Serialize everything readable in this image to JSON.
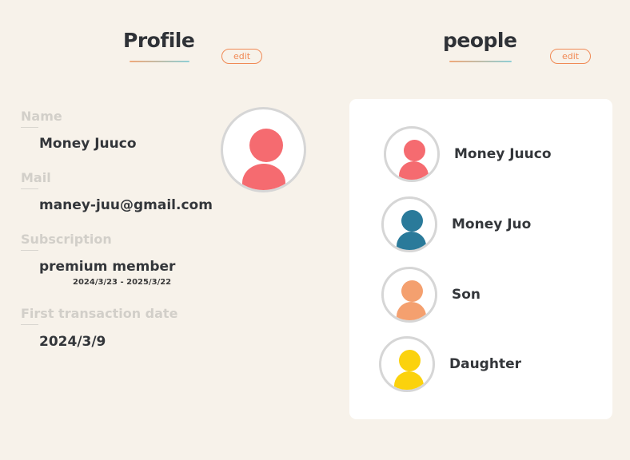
{
  "profile": {
    "title": "Profile",
    "edit_label": "edit",
    "fields": [
      {
        "label": "Name",
        "value": "Money Juuco"
      },
      {
        "label": "Mail",
        "value": "maney-juu@gmail.com"
      },
      {
        "label": "Subscription",
        "value": "premium member",
        "sub": "2024/3/23 - 2025/3/22"
      },
      {
        "label": "First transaction date",
        "value": "2024/3/9"
      }
    ],
    "avatar_color": "#f56b70"
  },
  "people": {
    "title": "people",
    "edit_label": "edit",
    "members": [
      {
        "name": "Money Juuco",
        "color": "#f56b70"
      },
      {
        "name": "Money Juo",
        "color": "#2a7a9a"
      },
      {
        "name": "Son",
        "color": "#f4a06f"
      },
      {
        "name": "Daughter",
        "color": "#fbd20d"
      }
    ]
  },
  "colors": {
    "background": "#f7f2ea",
    "accent": "#f08a55",
    "panel": "#ffffff"
  }
}
